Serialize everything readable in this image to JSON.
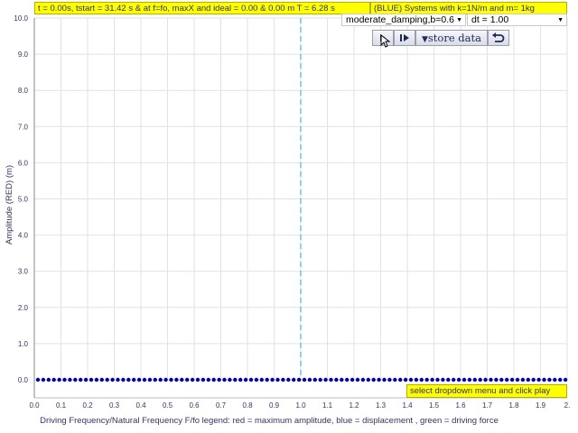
{
  "status_left": "t = 0.00s, tstart = 31.42 s & at f=fo, maxX and ideal = 0.00 & 0.00 m T = 6.28 s",
  "status_right": "(BLUE) Systems with k=1N/m and m= 1kg",
  "damping_select": {
    "selected": "moderate_damping,b=0.6"
  },
  "dt_select": {
    "selected": "dt = 1.00"
  },
  "toolbar": {
    "play_icon": "play-icon",
    "step_icon": "step-forward-icon",
    "store_label": "store data",
    "store_icon": "triangle-down-icon",
    "undo_icon": "undo-icon"
  },
  "hint": "select dropdown menu and click play",
  "chart_data": {
    "type": "scatter",
    "xlabel": "Driving Frequency/Natural Frequency F/fo legend: red = maximum amplitude, blue = displacement , green = driving force",
    "ylabel": "Amplitude (RED) (m)",
    "xlim": [
      0,
      2.0
    ],
    "ylim": [
      0,
      10.0
    ],
    "x_ticks": [
      "0.0",
      "0.1",
      "0.2",
      "0.3",
      "0.4",
      "0.5",
      "0.6",
      "0.7",
      "0.8",
      "0.9",
      "1.0",
      "1.1",
      "1.2",
      "1.3",
      "1.4",
      "1.5",
      "1.6",
      "1.7",
      "1.8",
      "1.9",
      "2."
    ],
    "y_ticks": [
      "0.0",
      "1.0",
      "2.0",
      "3.0",
      "4.0",
      "5.0",
      "6.0",
      "7.0",
      "8.0",
      "9.0",
      "10.0"
    ],
    "grid": true,
    "reference_line": {
      "x": 1.0,
      "color": "#22a6d6",
      "style": "dashed"
    },
    "series": [
      {
        "color": "#0000b0",
        "x": [
          0.0,
          0.02,
          0.04,
          0.06,
          0.08,
          0.1,
          0.12,
          0.14,
          0.16,
          0.18,
          0.2,
          0.22,
          0.24,
          0.26,
          0.28,
          0.3,
          0.32,
          0.34,
          0.36,
          0.38,
          0.4,
          0.42,
          0.44,
          0.46,
          0.48,
          0.5,
          0.52,
          0.54,
          0.56,
          0.58,
          0.6,
          0.62,
          0.64,
          0.66,
          0.68,
          0.7,
          0.72,
          0.74,
          0.76,
          0.78,
          0.8,
          0.82,
          0.84,
          0.86,
          0.88,
          0.9,
          0.92,
          0.94,
          0.96,
          0.98,
          1.0,
          1.02,
          1.04,
          1.06,
          1.08,
          1.1,
          1.12,
          1.14,
          1.16,
          1.18,
          1.2,
          1.22,
          1.24,
          1.26,
          1.28,
          1.3,
          1.32,
          1.34,
          1.36,
          1.38,
          1.4,
          1.42,
          1.44,
          1.46,
          1.48,
          1.5,
          1.52,
          1.54,
          1.56,
          1.58,
          1.6,
          1.62,
          1.64,
          1.66,
          1.68,
          1.7,
          1.72,
          1.74,
          1.76,
          1.78,
          1.8,
          1.82,
          1.84,
          1.86,
          1.88,
          1.9,
          1.92,
          1.94,
          1.96,
          1.98
        ],
        "y": [
          0,
          0,
          0,
          0,
          0,
          0,
          0,
          0,
          0,
          0,
          0,
          0,
          0,
          0,
          0,
          0,
          0,
          0,
          0,
          0,
          0,
          0,
          0,
          0,
          0,
          0,
          0,
          0,
          0,
          0,
          0,
          0,
          0,
          0,
          0,
          0,
          0,
          0,
          0,
          0,
          0,
          0,
          0,
          0,
          0,
          0,
          0,
          0,
          0,
          0,
          0,
          0,
          0,
          0,
          0,
          0,
          0,
          0,
          0,
          0,
          0,
          0,
          0,
          0,
          0,
          0,
          0,
          0,
          0,
          0,
          0,
          0,
          0,
          0,
          0,
          0,
          0,
          0,
          0,
          0,
          0,
          0,
          0,
          0,
          0,
          0,
          0,
          0,
          0,
          0,
          0,
          0,
          0,
          0,
          0,
          0,
          0,
          0,
          0,
          0
        ]
      }
    ]
  }
}
